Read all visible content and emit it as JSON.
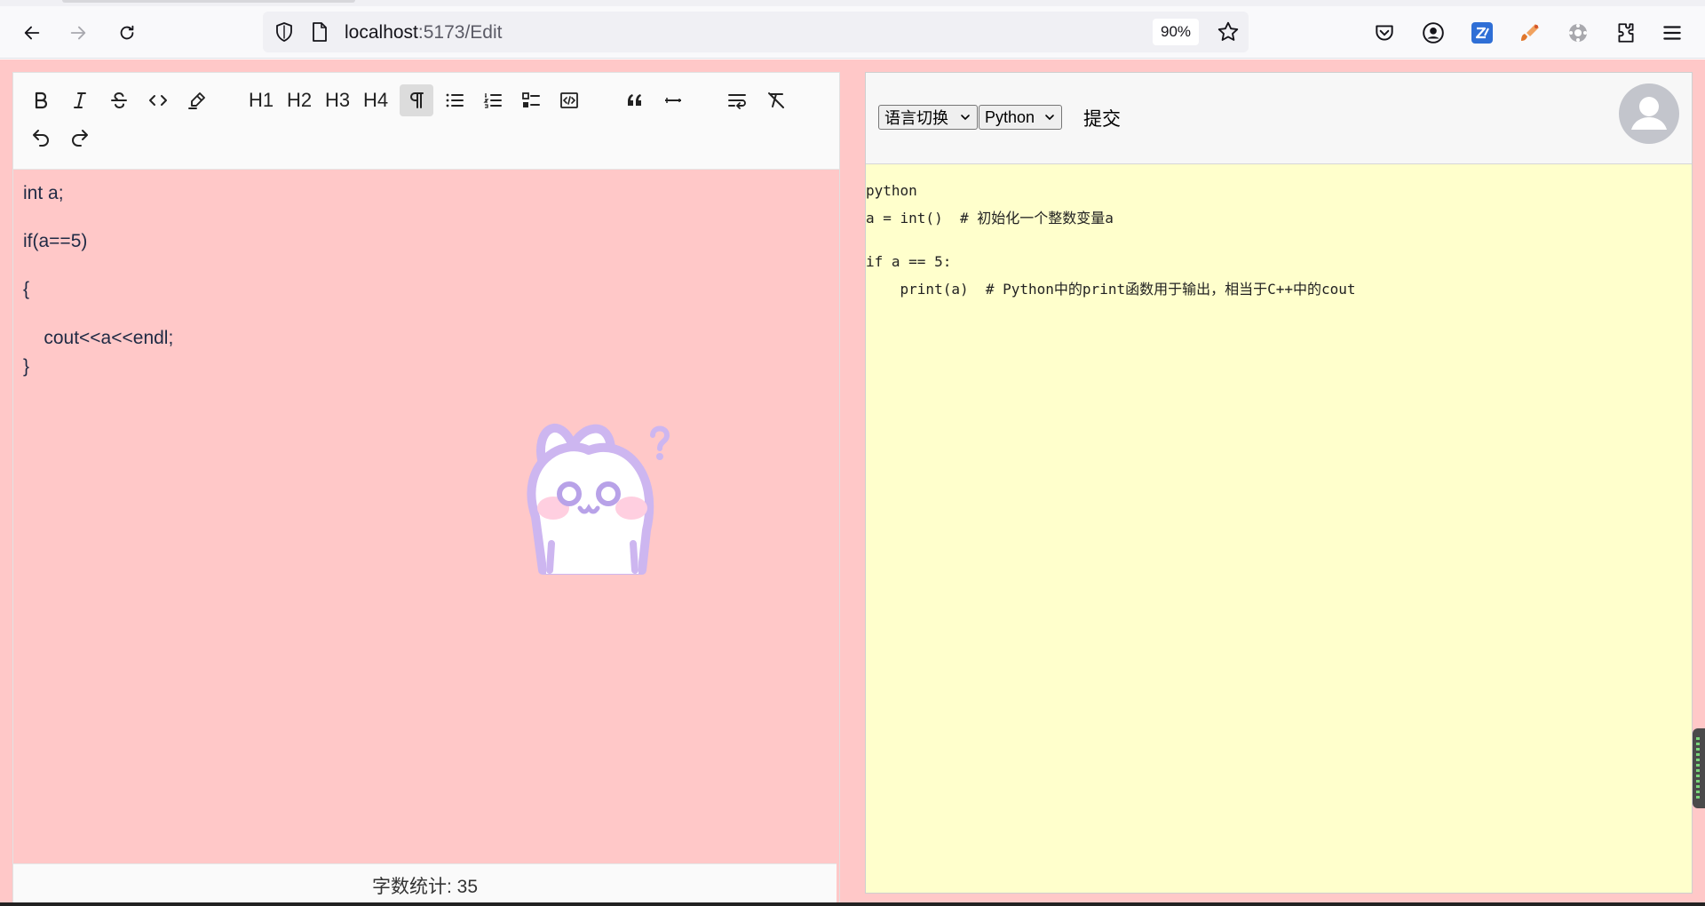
{
  "browser": {
    "url_host": "localhost",
    "url_path": ":5173/Edit",
    "zoom": "90%"
  },
  "editor": {
    "toolbar": {
      "h1": "H1",
      "h2": "H2",
      "h3": "H3",
      "h4": "H4"
    },
    "lines": [
      "int a;",
      "if(a==5)",
      "{",
      "    cout<<a<<endl;",
      "}"
    ],
    "word_count": "字数统计: 35"
  },
  "right": {
    "language_select": "语言切换",
    "language_value": "Python",
    "submit_label": "提交",
    "output_lines": [
      "python",
      "a = int()  # 初始化一个整数变量a",
      "",
      "if a == 5:",
      "    print(a)  # Python中的print函数用于输出，相当于C++中的cout"
    ]
  },
  "colors": {
    "left_bg": "#ffc8c8",
    "right_output_bg": "#ffffcc"
  }
}
